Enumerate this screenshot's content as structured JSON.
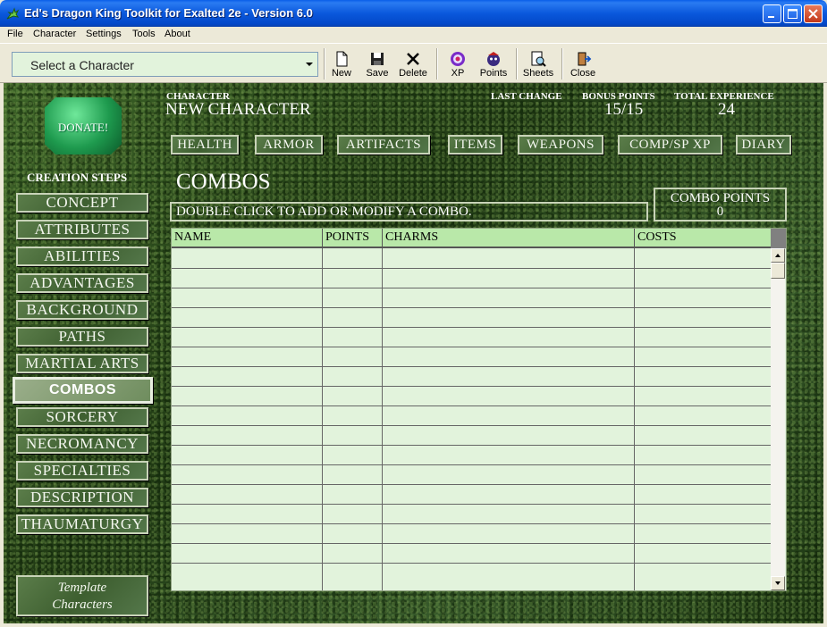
{
  "window": {
    "title": "Ed's Dragon King Toolkit for Exalted 2e - Version 6.0"
  },
  "menu": [
    "File",
    "Character",
    "Settings",
    "Tools",
    "About"
  ],
  "toolbar": {
    "character_select": "Select a Character",
    "buttons": {
      "new": "New",
      "save": "Save",
      "delete": "Delete",
      "xp": "XP",
      "points": "Points",
      "sheets": "Sheets",
      "close": "Close"
    }
  },
  "sidebar": {
    "donate": "DONATE!",
    "creation_steps": "CREATION STEPS",
    "steps": [
      "Concept",
      "Attributes",
      "Abilities",
      "Advantages",
      "Background",
      "Paths",
      "Martial Arts",
      "Combos",
      "Sorcery",
      "Necromancy",
      "Specialties",
      "Description",
      "Thaumaturgy"
    ],
    "active_step": "Combos",
    "template_line1": "Template",
    "template_line2": "Characters"
  },
  "header": {
    "character_label": "CHARACTER",
    "character_name": "NEW CHARACTER",
    "last_change_label": "LAST CHANGE",
    "last_change_value": "",
    "bonus_points_label": "BONUS POINTS",
    "bonus_points_value": "15/15",
    "total_experience_label": "TOTAL EXPERIENCE",
    "total_experience_value": "24"
  },
  "tabs": [
    "Health",
    "Armor",
    "Artifacts",
    "Items",
    "Weapons",
    "Comp/Sp XP",
    "Diary"
  ],
  "page": {
    "title": "COMBOS",
    "instruction": "DOUBLE CLICK TO ADD OR MODIFY A COMBO.",
    "combo_points_label": "COMBO POINTS",
    "combo_points_value": "0"
  },
  "grid": {
    "columns": [
      "NAME",
      "POINTS",
      "CHARMS",
      "COSTS"
    ],
    "rows": []
  }
}
